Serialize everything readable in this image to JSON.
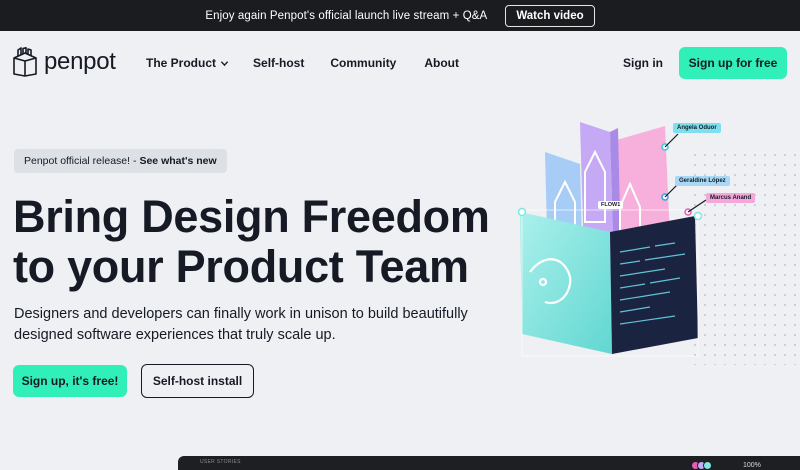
{
  "announcement": {
    "text": "Enjoy again Penpot's official launch live stream + Q&A",
    "button_label": "Watch video"
  },
  "nav": {
    "logo_text": "penpot",
    "links": [
      {
        "label": "The Product"
      },
      {
        "label": "Self-host"
      },
      {
        "label": "Community"
      },
      {
        "label": "About"
      }
    ],
    "sign_in": "Sign in",
    "sign_up": "Sign up for free"
  },
  "hero": {
    "badge_text": "Penpot official release! -",
    "badge_link": "See what's new",
    "headline_line1": "Bring Design Freedom",
    "headline_line2": "to your Product Team",
    "subheading": "Designers and developers can finally work in unison to build beautifully designed software experiences that truly scale up.",
    "cta_primary": "Sign up, it's free!",
    "cta_secondary": "Self-host install"
  },
  "illustration": {
    "tags": [
      "Angela Oduor",
      "Geraldine López",
      "Marcus Anand"
    ],
    "flow_label": "FLOW1"
  },
  "app_preview": {
    "label": "USER STORIES",
    "zoom": "100%"
  },
  "colors": {
    "accent": "#31efb8",
    "dark": "#1b1c1f",
    "background": "#eef0f3",
    "text": "#151a24"
  }
}
